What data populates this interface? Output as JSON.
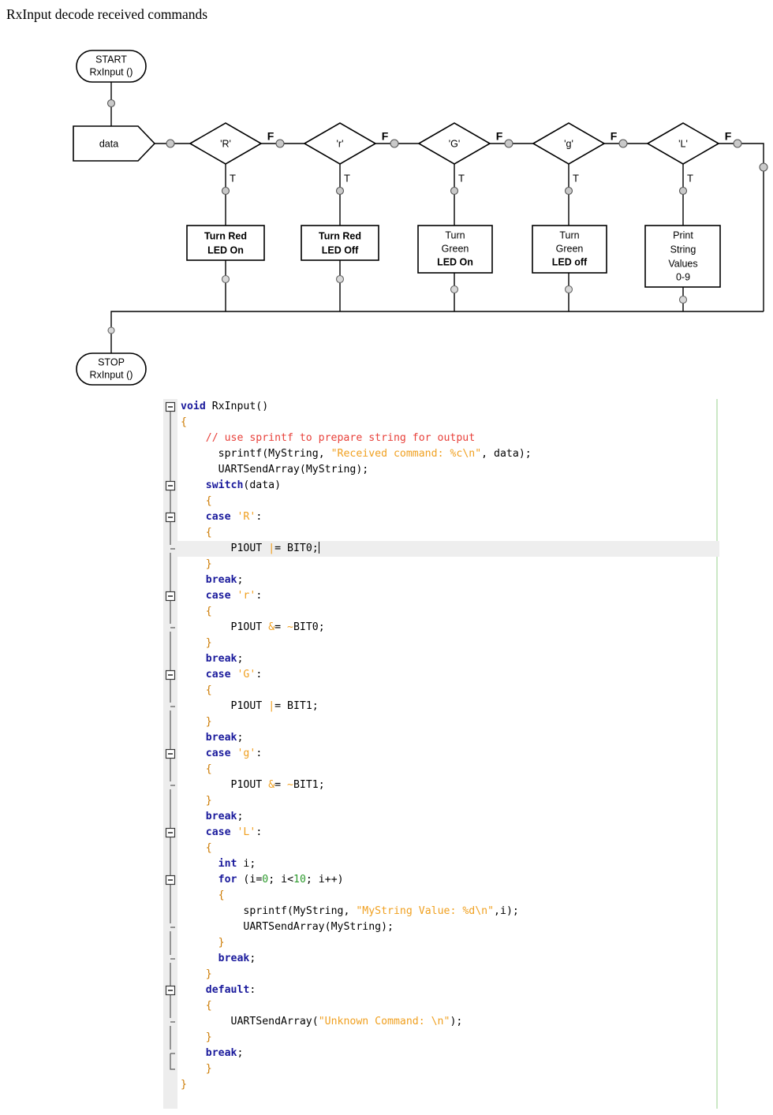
{
  "document": {
    "title": "RxInput decode received commands"
  },
  "flowchart": {
    "start_node": {
      "line1": "START",
      "line2": "RxInput ()"
    },
    "stop_node": {
      "line1": "STOP",
      "line2": "RxInput ()"
    },
    "data_node": {
      "label": "data"
    },
    "true_label": "T",
    "false_label": "F",
    "branches": [
      {
        "condition": "'R'",
        "action_lines": [
          "Turn Red",
          "LED On"
        ]
      },
      {
        "condition": "'r'",
        "action_lines": [
          "Turn Red",
          "LED Off"
        ]
      },
      {
        "condition": "'G'",
        "action_lines": [
          "Turn",
          "Green",
          "LED On"
        ]
      },
      {
        "condition": "'g'",
        "action_lines": [
          "Turn",
          "Green",
          "LED off"
        ]
      },
      {
        "condition": "'L'",
        "action_lines": [
          "Print",
          "String",
          "Values",
          "0-9"
        ]
      }
    ]
  },
  "editor": {
    "current_line_number": 8,
    "margin_color": "#cce8c6",
    "current_line_color": "#eeeeee",
    "gutter_color": "#ededed",
    "syntax_colors": {
      "keyword": "#1a1a9c",
      "comment": "#e8403a",
      "string": "#f0a020",
      "number": "#2e9b2e",
      "brace": "#cc7a00",
      "identifier": "#000000"
    },
    "code_text": "void RxInput()\n{\n    // use sprintf to prepare string for output\n      sprintf(MyString, \"Received command: %c\\n\", data);\n      UARTSendArray(MyString);\n    switch(data)\n    {\n    case 'R':\n    {\n        P1OUT |= BIT0;\n    }\n    break;\n    case 'r':\n    {\n        P1OUT &= ~BIT0;\n    }\n    break;\n    case 'G':\n    {\n        P1OUT |= BIT1;\n    }\n    break;\n    case 'g':\n    {\n        P1OUT &= ~BIT1;\n    }\n    break;\n    case 'L':\n    {\n      int i;\n      for (i=0; i<10; i++)\n      {\n          sprintf(MyString, \"MyString Value: %d\\n\",i);\n          UARTSendArray(MyString);\n      }\n      break;\n    }\n    default:\n    {\n        UARTSendArray(\"Unknown Command: \\n\");\n    }\n    break;\n    }\n}",
    "fold_markers": [
      {
        "line": 1,
        "type": "minus"
      },
      {
        "line": 6,
        "type": "minus"
      },
      {
        "line": 8,
        "type": "minus"
      },
      {
        "line": 10,
        "type": "tick"
      },
      {
        "line": 13,
        "type": "minus"
      },
      {
        "line": 15,
        "type": "tick"
      },
      {
        "line": 18,
        "type": "minus"
      },
      {
        "line": 20,
        "type": "tick"
      },
      {
        "line": 23,
        "type": "minus"
      },
      {
        "line": 25,
        "type": "tick"
      },
      {
        "line": 28,
        "type": "minus"
      },
      {
        "line": 31,
        "type": "minus"
      },
      {
        "line": 34,
        "type": "tick"
      },
      {
        "line": 36,
        "type": "tick"
      },
      {
        "line": 38,
        "type": "minus"
      },
      {
        "line": 40,
        "type": "tick"
      },
      {
        "line": 42,
        "type": "tick"
      }
    ]
  }
}
